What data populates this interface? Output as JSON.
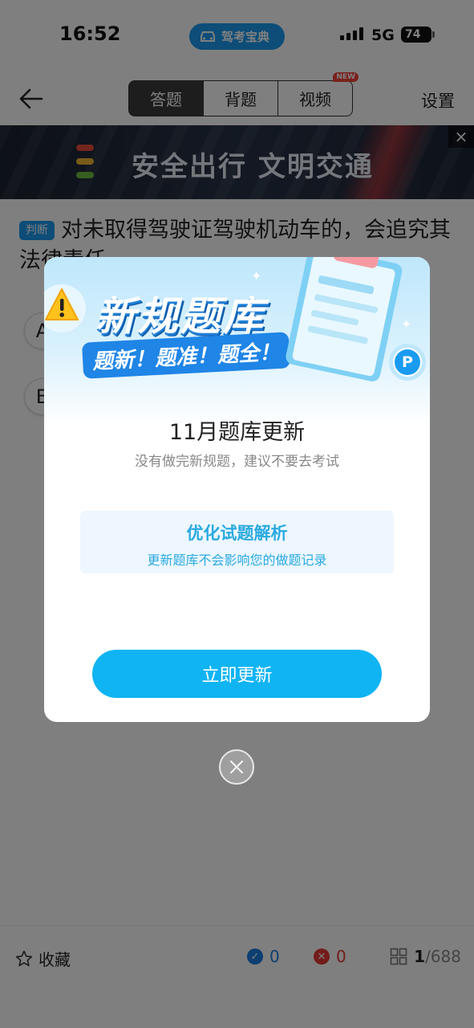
{
  "status": {
    "time": "16:52",
    "app_name": "驾考宝典",
    "network": "5G",
    "battery": "74"
  },
  "nav": {
    "tabs": [
      {
        "label": "答题",
        "active": true
      },
      {
        "label": "背题"
      },
      {
        "label": "视频",
        "badge": "NEW"
      }
    ],
    "settings": "设置"
  },
  "banner": {
    "text": "安全出行 文明交通",
    "close": "×"
  },
  "question": {
    "tag": "判断",
    "text": "对未取得驾驶证驾驶机动车的，会追究其法律责任。",
    "options": [
      "A",
      "B"
    ]
  },
  "modal": {
    "promo_title": "新规题库",
    "promo_sub": "题新！题准！题全！",
    "title": "11月题库更新",
    "subtitle": "没有做完新规题，建议不要去考试",
    "box_title": "优化试题解析",
    "box_sub": "更新题库不会影响您的做题记录",
    "button": "立即更新",
    "badge_letter": "P"
  },
  "bottom": {
    "favorite": "收藏",
    "correct": "0",
    "wrong": "0",
    "current": "1",
    "total": "/688"
  },
  "colors": {
    "accent": "#1a9bf0",
    "button": "#10b4f3",
    "wrong": "#e53935",
    "correct": "#1a7fe0"
  }
}
